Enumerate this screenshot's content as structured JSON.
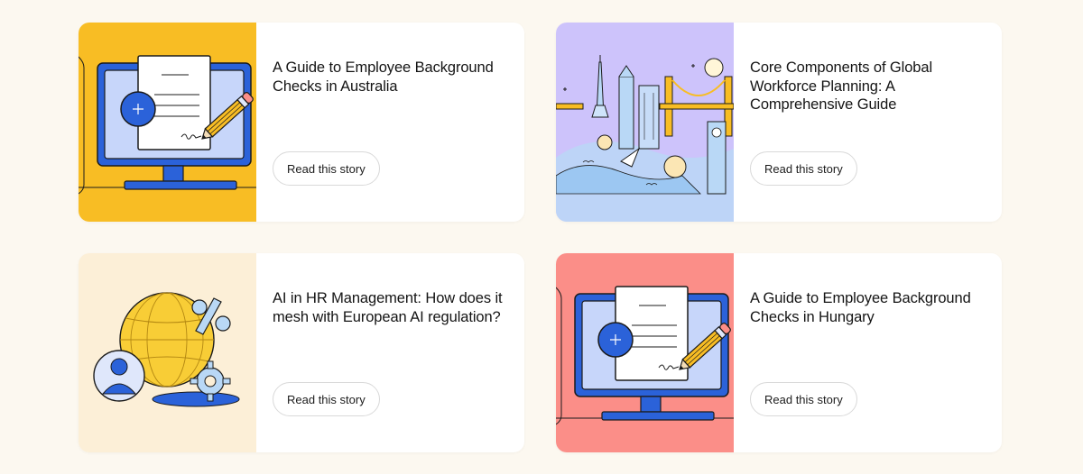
{
  "colors": {
    "page_bg": "#fcf8f0",
    "card_bg": "#ffffff",
    "art_yellow": "#f8bd24",
    "art_lavender": "#cdc3fb",
    "art_cream": "#fcefd7",
    "art_salmon": "#fb8e88",
    "accent_blue": "#2b62d9"
  },
  "cards": [
    {
      "title": "A Guide to Employee Background Checks in Australia",
      "cta_label": "Read this story",
      "illustration": "computer-document-pencil-icon"
    },
    {
      "title": "Core Components of Global Workforce Planning: A Comprehensive Guide",
      "cta_label": "Read this story",
      "illustration": "global-cities-landmarks-icon"
    },
    {
      "title": "AI in HR Management: How does it mesh with European AI regulation?",
      "cta_label": "Read this story",
      "illustration": "globe-percent-person-gear-icon"
    },
    {
      "title": "A Guide to Employee Background Checks in Hungary",
      "cta_label": "Read this story",
      "illustration": "computer-document-pencil-icon"
    }
  ]
}
